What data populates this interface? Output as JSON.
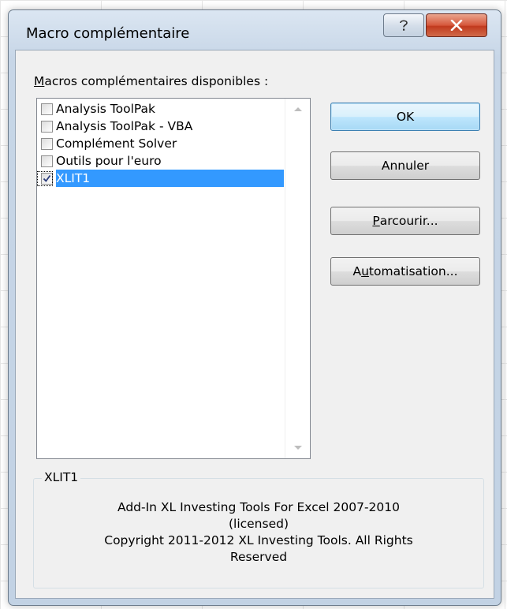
{
  "dialog": {
    "title": "Macro complémentaire",
    "help_icon": "question-icon",
    "close_icon": "close-x-icon"
  },
  "list": {
    "label_first": "M",
    "label_rest": "acros complémentaires disponibles :",
    "items": [
      {
        "label": "Analysis ToolPak",
        "checked": false,
        "selected": false
      },
      {
        "label": "Analysis ToolPak - VBA",
        "checked": false,
        "selected": false
      },
      {
        "label": "Complément Solver",
        "checked": false,
        "selected": false
      },
      {
        "label": "Outils pour l'euro",
        "checked": false,
        "selected": false
      },
      {
        "label": "XLIT1",
        "checked": true,
        "selected": true
      }
    ]
  },
  "buttons": {
    "ok": "OK",
    "cancel": "Annuler",
    "browse_first": "P",
    "browse_rest": "arcourir...",
    "automation_first": "A",
    "automation_mid": "u",
    "automation_rest": "tomatisation..."
  },
  "details": {
    "group_title": "XLIT1",
    "line1": "Add-In XL Investing Tools For Excel 2007-2010",
    "line2": "(licensed)",
    "line3": "Copyright 2011-2012 XL Investing Tools. All Rights",
    "line4": "Reserved"
  },
  "colors": {
    "selection": "#3399ff",
    "close_button": "#c13a1e"
  }
}
